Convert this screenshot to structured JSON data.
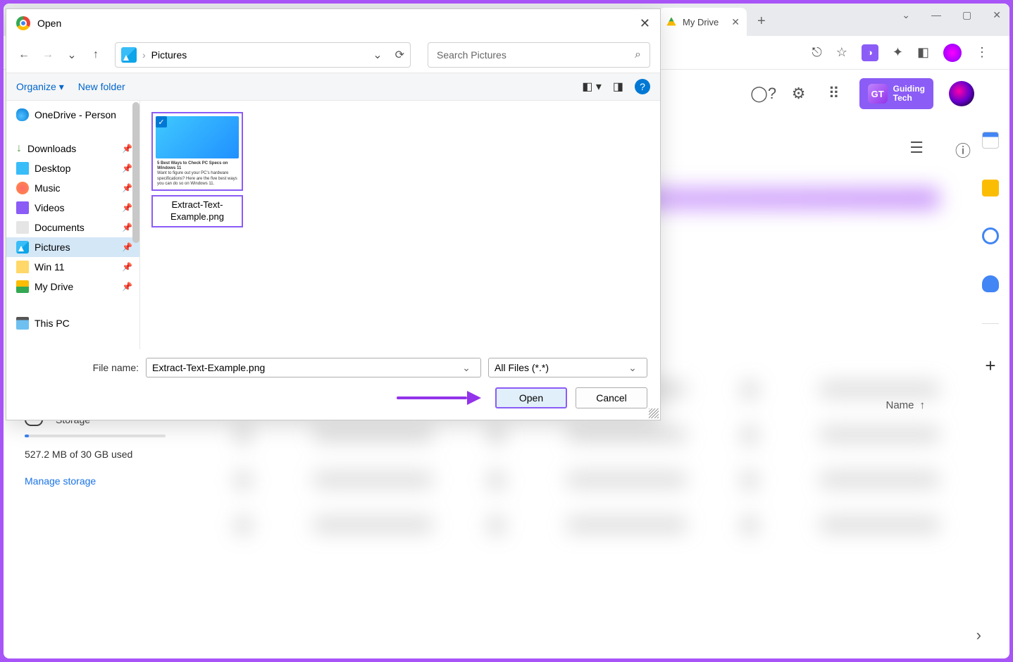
{
  "browser": {
    "tab_title": "My Drive",
    "win_min": "⌄",
    "win_restore": "—",
    "win_max": "▢",
    "win_close": "✕",
    "new_tab": "+"
  },
  "drive": {
    "gt_text": "Guiding\nTech",
    "name_col": "Name",
    "storage_label": "Storage",
    "used": "527.2 MB of 30 GB used",
    "manage": "Manage storage"
  },
  "dialog": {
    "title": "Open",
    "breadcrumb": "Pictures",
    "search_ph": "Search Pictures",
    "organize": "Organize",
    "new_folder": "New folder",
    "tree": {
      "onedrive": "OneDrive - Person",
      "downloads": "Downloads",
      "desktop": "Desktop",
      "music": "Music",
      "videos": "Videos",
      "documents": "Documents",
      "pictures": "Pictures",
      "win11": "Win 11",
      "mydrive": "My Drive",
      "thispc": "This PC"
    },
    "file": {
      "name": "Extract-Text-Example.png",
      "thumb_title": "5 Best Ways to Check PC Specs on Windows 11",
      "thumb_sub": "Want to figure out your PC's hardware specifications? Here are the five best ways you can do so on Windows 11."
    },
    "fn_label": "File name:",
    "fn_value": "Extract-Text-Example.png",
    "filter": "All Files (*.*)",
    "open": "Open",
    "cancel": "Cancel"
  }
}
